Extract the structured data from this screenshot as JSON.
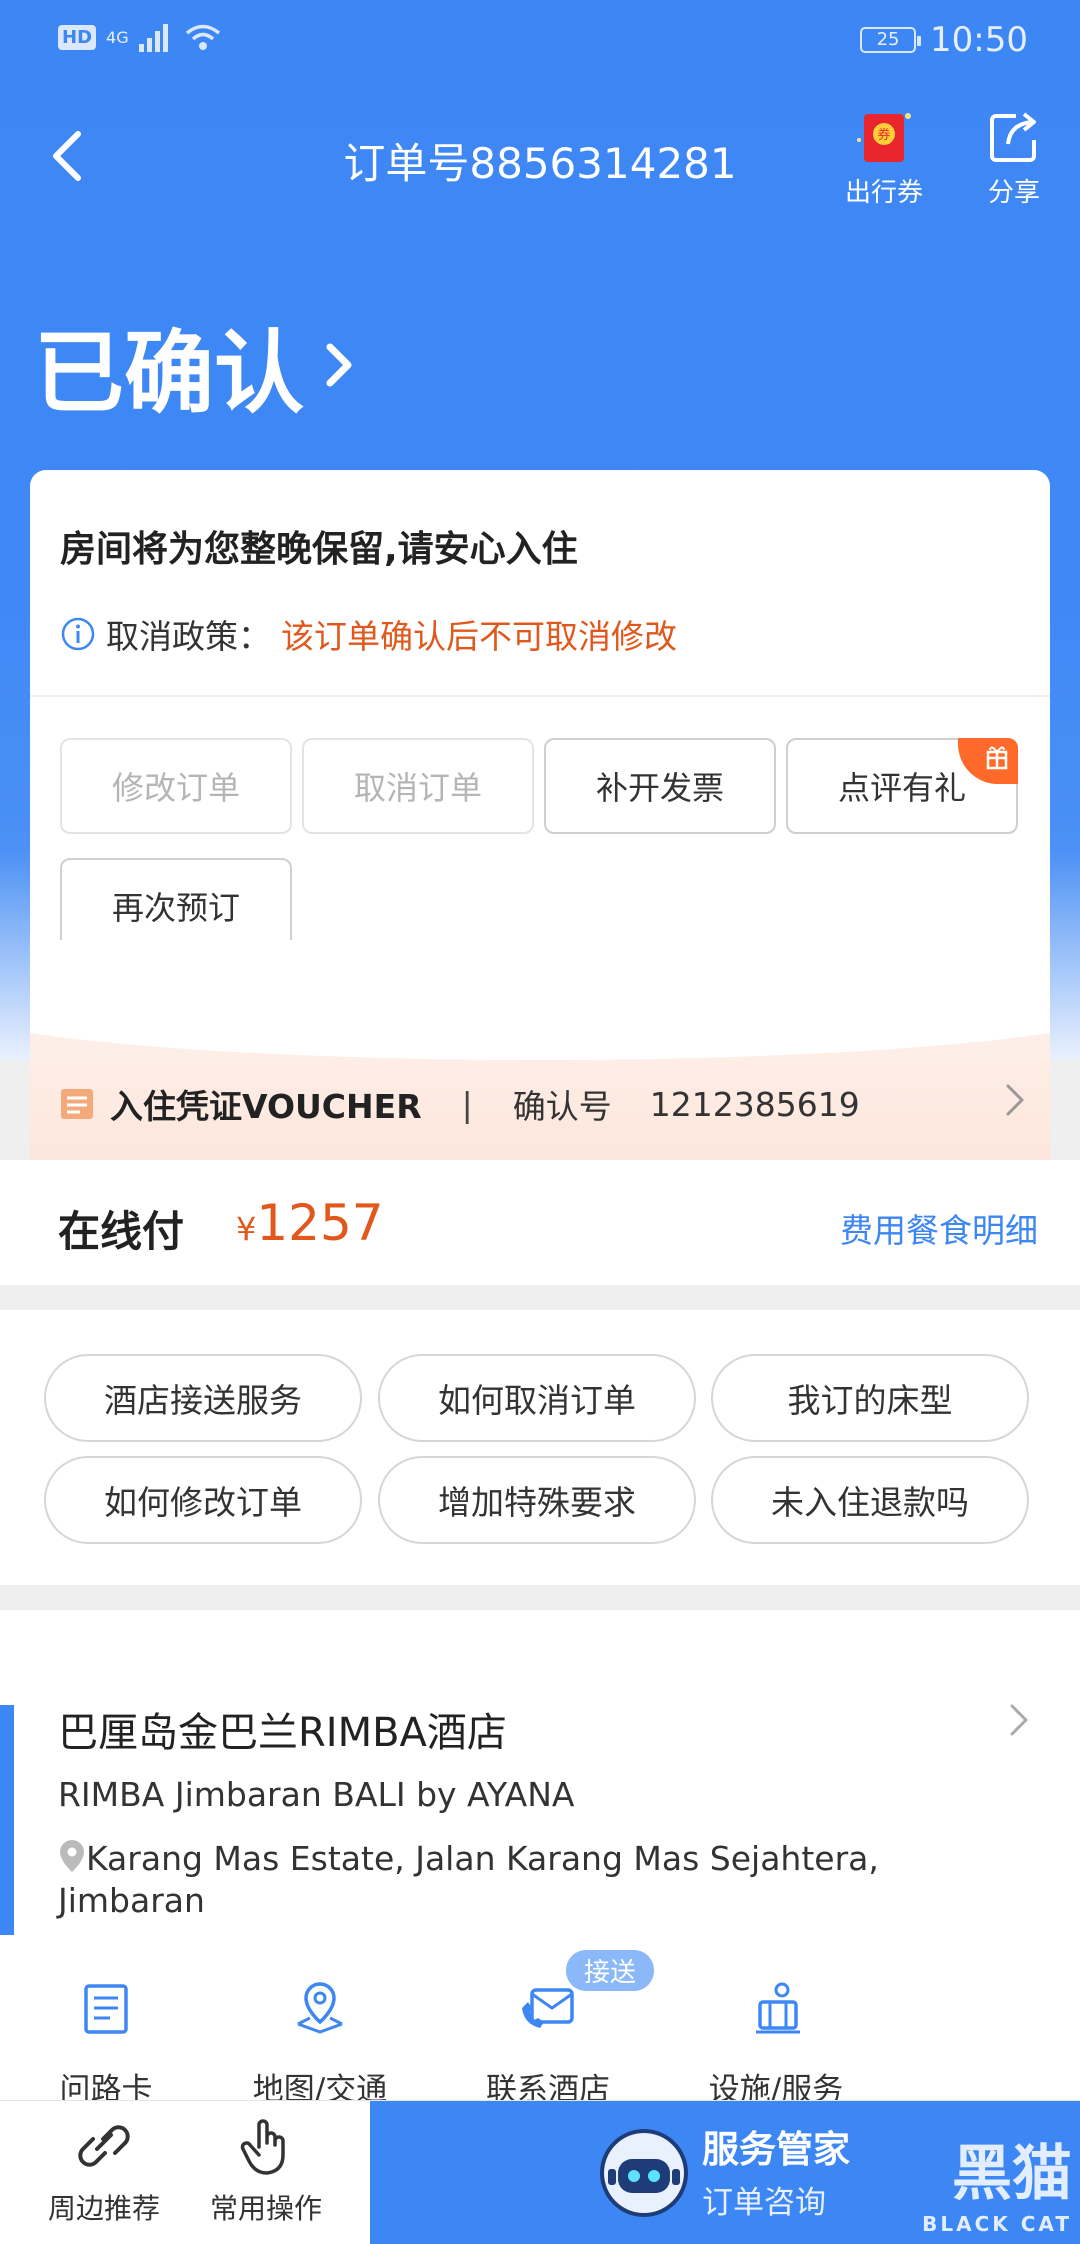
{
  "status_bar": {
    "net_hd": "HD",
    "net_4g": "4G",
    "battery": "25",
    "time": "10:50"
  },
  "nav": {
    "title": "订单号8856314281",
    "coupon_label": "出行券",
    "share_label": "分享"
  },
  "order_status": "已确认",
  "card": {
    "headline": "房间将为您整晚保留,请安心入住",
    "policy_label": "取消政策：",
    "policy_value": "该订单确认后不可取消修改",
    "buttons": [
      {
        "label": "修改订单",
        "enabled": false
      },
      {
        "label": "取消订单",
        "enabled": false
      },
      {
        "label": "补开发票",
        "enabled": true
      },
      {
        "label": "点评有礼",
        "enabled": true
      },
      {
        "label": "再次预订",
        "enabled": true
      }
    ],
    "voucher": {
      "title": "入住凭证VOUCHER",
      "separator": "|",
      "confirm_label": "确认号",
      "confirm_no": "1212385619"
    }
  },
  "payment": {
    "label": "在线付",
    "currency": "¥",
    "amount": "1257",
    "detail_link": "费用餐食明细"
  },
  "faq": [
    "酒店接送服务",
    "如何取消订单",
    "我订的床型",
    "如何修改订单",
    "增加特殊要求",
    "未入住退款吗"
  ],
  "hotel": {
    "name": "巴厘岛金巴兰RIMBA酒店",
    "name_en": "RIMBA Jimbaran BALI by AYANA",
    "address": "Karang Mas Estate, Jalan Karang Mas Sejahtera, Jimbaran",
    "pickup_badge": "接送",
    "actions": [
      "问路卡",
      "地图/交通",
      "联系酒店",
      "设施/服务"
    ]
  },
  "bottom_bar": {
    "nearby": "周边推荐",
    "common_ops": "常用操作",
    "service_title": "服务管家",
    "service_sub": "订单咨询",
    "watermark": "黑猫",
    "watermark_sub": "BLACK CAT"
  },
  "colors": {
    "brand_blue": "#3d87f5",
    "accent_orange": "#e0581c"
  }
}
